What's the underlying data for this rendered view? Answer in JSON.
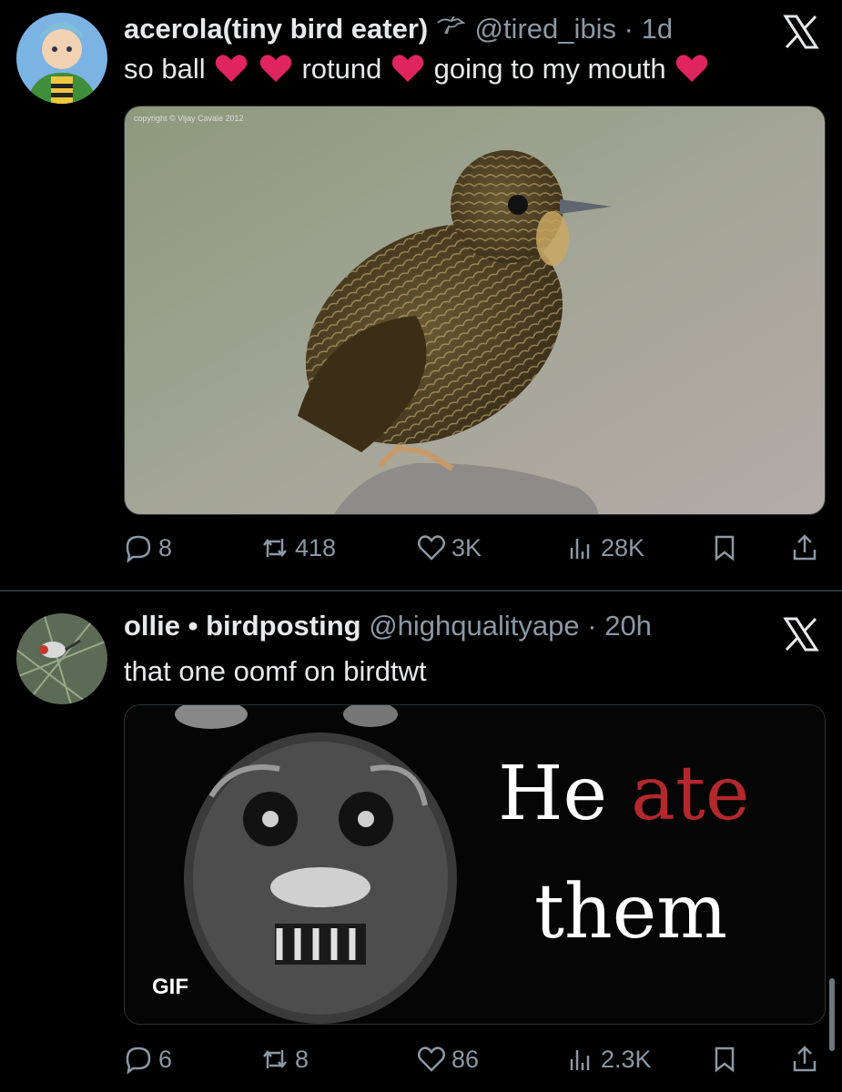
{
  "tweets": [
    {
      "display_name": "acerola(tiny bird eater)",
      "handle": "@tired_ibis",
      "separator": "·",
      "time": "1d",
      "text_parts": [
        "so ball",
        "rotund",
        "going to my mouth"
      ],
      "media_watermark": "copyright © Vijay Cavale 2012",
      "stats": {
        "replies": "8",
        "retweets": "418",
        "likes": "3K",
        "views": "28K"
      }
    },
    {
      "display_name": "ollie • birdposting",
      "handle": "@highqualityape",
      "separator": "·",
      "time": "20h",
      "text": "that one oomf on birdtwt",
      "gif_label": "GIF",
      "meme_line1_a": "He",
      "meme_line1_b": "ate",
      "meme_line2": "them",
      "stats": {
        "replies": "6",
        "retweets": "8",
        "likes": "86",
        "views": "2.3K"
      }
    }
  ],
  "icons": [
    "bird-icon",
    "heart-emoji",
    "x-logo-icon",
    "reply-icon",
    "retweet-icon",
    "like-icon",
    "views-icon",
    "bookmark-icon",
    "share-icon"
  ],
  "colors": {
    "background": "#000000",
    "text": "#e7e9ea",
    "muted": "#8b98a5",
    "heart": "#e0245e",
    "meme_red": "#b3282d"
  }
}
